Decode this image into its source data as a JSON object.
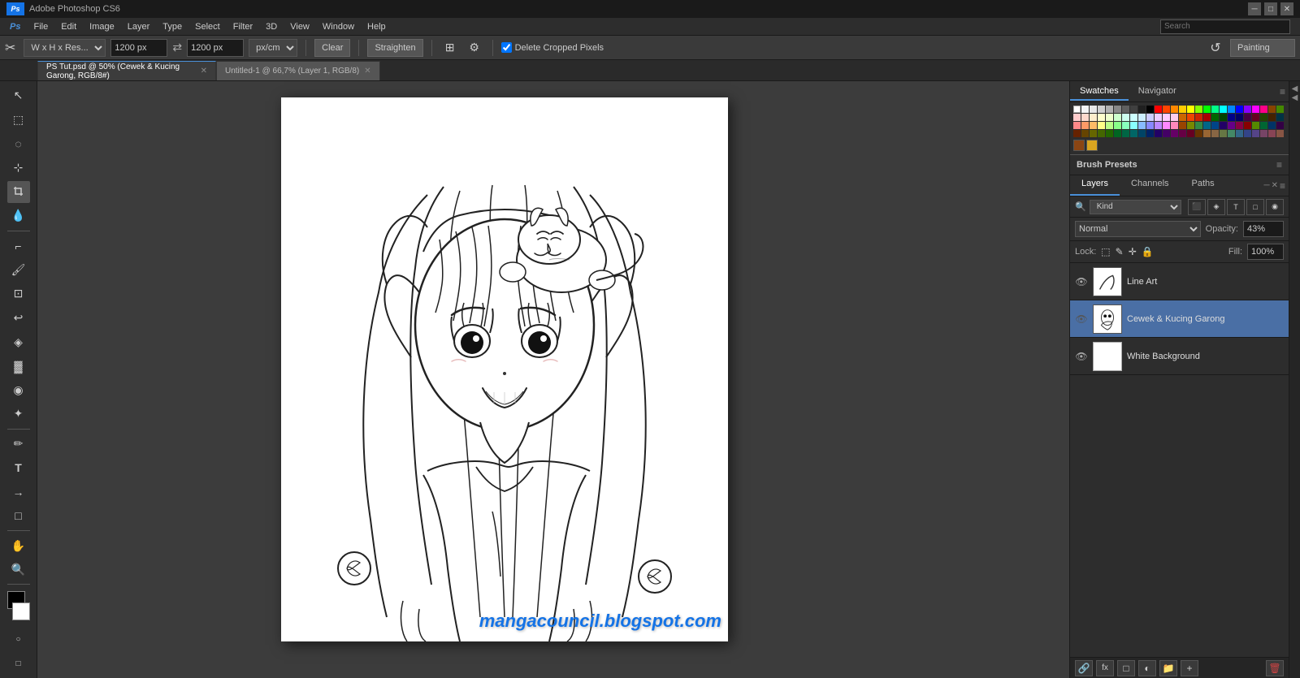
{
  "titlebar": {
    "title": "Adobe Photoshop CS6",
    "minimize": "─",
    "maximize": "□",
    "close": "✕"
  },
  "menubar": {
    "items": [
      "PS",
      "File",
      "Edit",
      "Image",
      "Layer",
      "Type",
      "Select",
      "Filter",
      "3D",
      "View",
      "Window",
      "Help"
    ]
  },
  "optionsbar": {
    "tool_icon": "⊹",
    "dimension_mode": "W x H x Res...",
    "width_value": "1200 px",
    "height_value": "1200 px",
    "resolution_unit": "px/cm",
    "clear_btn": "Clear",
    "straighten_btn": "Straighten",
    "grid_btn": "⊞",
    "settings_btn": "⚙",
    "delete_cropped": "Delete Cropped Pixels",
    "reset_btn": "↺",
    "workspace_label": "Painting"
  },
  "tabs": [
    {
      "label": "PS Tut.psd @ 50% (Cewek & Kucing Garong, RGB/8#)",
      "active": true,
      "closeable": true
    },
    {
      "label": "Untitled-1 @ 66,7% (Layer 1, RGB/8)",
      "active": false,
      "closeable": true
    }
  ],
  "lefttools": [
    {
      "icon": "↖",
      "name": "move-tool"
    },
    {
      "icon": "⬚",
      "name": "marquee-tool"
    },
    {
      "icon": "⌐",
      "name": "lasso-tool"
    },
    {
      "icon": "⊹",
      "name": "quick-select-tool"
    },
    {
      "icon": "✂",
      "name": "crop-tool"
    },
    {
      "icon": "⊡",
      "name": "eyedropper-tool"
    },
    {
      "icon": "✎",
      "name": "healing-brush-tool"
    },
    {
      "icon": "🖌",
      "name": "brush-tool"
    },
    {
      "icon": "⊕",
      "name": "clone-stamp-tool"
    },
    {
      "icon": "⌂",
      "name": "history-brush-tool"
    },
    {
      "icon": "◈",
      "name": "eraser-tool"
    },
    {
      "icon": "▓",
      "name": "gradient-tool"
    },
    {
      "icon": "◉",
      "name": "blur-tool"
    },
    {
      "icon": "✦",
      "name": "dodge-tool"
    },
    {
      "icon": "✏",
      "name": "pen-tool"
    },
    {
      "icon": "T",
      "name": "type-tool"
    },
    {
      "icon": "→",
      "name": "path-select-tool"
    },
    {
      "icon": "□",
      "name": "shape-tool"
    },
    {
      "icon": "✋",
      "name": "hand-tool"
    },
    {
      "icon": "🔍",
      "name": "zoom-tool"
    }
  ],
  "swatches": {
    "rows": [
      [
        "#ffffff",
        "#000000",
        "#ff0000",
        "#00ff00",
        "#0000ff",
        "#ffff00",
        "#ff00ff",
        "#00ffff",
        "#ff8800",
        "#8800ff",
        "#00ff88",
        "#ff0088",
        "#888888",
        "#444444",
        "#cc0000",
        "#00cc00",
        "#0000cc",
        "#cccc00",
        "#cc00cc",
        "#00cccc",
        "#cc6600",
        "#6600cc",
        "#00cc66",
        "#cc0066",
        "#aaaaaa",
        "#222222"
      ],
      [
        "#ffcccc",
        "#ccffcc",
        "#ccccff",
        "#ffffcc",
        "#ffccff",
        "#ccffff",
        "#ffddaa",
        "#ddaaff",
        "#aaffdd",
        "#ffaadd",
        "#dddddd",
        "#bbbbbb",
        "#999999",
        "#777777",
        "#555555",
        "#333333",
        "#ff6666",
        "#66ff66",
        "#6666ff",
        "#ffff66",
        "#ff66ff",
        "#66ffff",
        "#ff9933",
        "#9933ff",
        "#33ff99",
        "#ff3399"
      ],
      [
        "#330000",
        "#003300",
        "#000033",
        "#333300",
        "#330033",
        "#003333",
        "#663300",
        "#330066",
        "#006633",
        "#660033",
        "#ff4444",
        "#44ff44",
        "#4444ff",
        "#ffff44",
        "#ff44ff",
        "#44ffff",
        "#ff7700",
        "#7700ff",
        "#00ff77",
        "#ff0077",
        "#771100",
        "#117700",
        "#001177",
        "#777700",
        "#770077",
        "#007777"
      ],
      [
        "#ffeecc",
        "#eeccff",
        "#ccffee",
        "#ffeeff",
        "#eeffcc",
        "#cceeee",
        "#ff8844",
        "#88ff44",
        "#4488ff",
        "#ff44aa",
        "#aa44ff",
        "#44ffaa",
        "#dd8800",
        "#8800dd",
        "#00dd88",
        "#dd0088",
        "#885500",
        "#550088",
        "#008855",
        "#880055",
        "#cc9900",
        "#9900cc",
        "#00cc99",
        "#cc0099",
        "#aacc00",
        "#00aacc"
      ]
    ],
    "bottom_colors": [
      "#aa6600",
      "#cc8800"
    ]
  },
  "brushpresets": {
    "label": "Brush Presets"
  },
  "layerspanel": {
    "tabs": [
      "Layers",
      "Channels",
      "Paths"
    ],
    "active_tab": "Layers",
    "filter_label": "Kind",
    "blend_mode": "Normal",
    "opacity_label": "Opacity:",
    "opacity_value": "43%",
    "lock_label": "Lock:",
    "fill_label": "Fill:",
    "fill_value": "100%",
    "layers": [
      {
        "name": "Line Art",
        "visible": true,
        "selected": false,
        "thumb_type": "white_thumb"
      },
      {
        "name": "Cewek & Kucing Garong",
        "visible": false,
        "selected": true,
        "thumb_type": "content_thumb"
      },
      {
        "name": "White Background",
        "visible": true,
        "selected": false,
        "thumb_type": "white_thumb"
      }
    ]
  },
  "watermark": "mangacouncil.blogspot.com"
}
